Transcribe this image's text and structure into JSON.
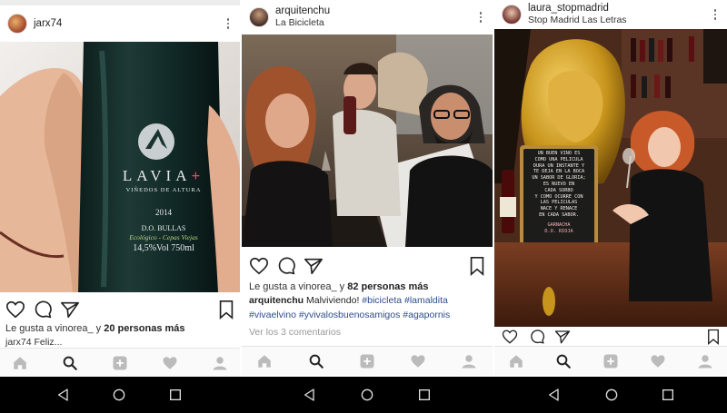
{
  "posts": [
    {
      "username": "jarx74",
      "location": "",
      "likes_prefix": "Le gusta a vinorea_ y ",
      "likes_count": "20 personas más",
      "caption_user": "",
      "caption_text": "",
      "caption_tags": [],
      "comments_link": "",
      "cutoff_text": "jarx74 Feliz...",
      "label": {
        "brand": "LAVIA",
        "brand_mark": "+",
        "subtitle": "VIÑEDOS DE ALTURA",
        "year": "2014",
        "do": "D.O. BULLAS",
        "eco": "Ecológico - Cepas Viejas",
        "abv": "14,5%Vol 750ml"
      }
    },
    {
      "username": "arquitenchu",
      "location": "La Bicicleta",
      "likes_prefix": "Le gusta a vinorea_ y ",
      "likes_count": "82 personas más",
      "caption_user": "arquitenchu",
      "caption_text": " Malviviendo! ",
      "caption_tags": [
        "#bicicleta",
        "#lamaldita",
        "#vivaelvino",
        "#yvivalosbuenosamigos",
        "#agapornis"
      ],
      "comments_link": "Ver los 3 comentarios"
    },
    {
      "username": "laura_stopmadrid",
      "location": "Stop Madrid Las Letras",
      "likes_prefix": "",
      "likes_count": "",
      "caption_user": "",
      "caption_text": "",
      "caption_tags": [],
      "comments_link": "",
      "chalkboard": [
        "UN BUEN VINO ES",
        "COMO UNA PELICULA",
        "DURA UN INSTANTE Y",
        "TE DEJA EN LA BOCA",
        "UN SABOR DE GLORIA;",
        "ES NUEVO EN",
        "CADA SORBO",
        "Y COMO OCURRE CON",
        "LAS PELICULAS",
        "NACE Y RENACE",
        "EN CADA SABOR."
      ],
      "chalk_footer": "GARNACHA",
      "chalk_footer2": "D.O. RIOJA"
    }
  ],
  "theme": {
    "tag_color": "#2e4e8c",
    "nav_bg": "#fafafa",
    "system_bar": "#000000"
  },
  "icons": {
    "post_actions": [
      "heart-icon",
      "comment-icon",
      "share-icon",
      "bookmark-icon"
    ],
    "nav": [
      "home-icon",
      "search-icon",
      "add-icon",
      "activity-heart-icon",
      "profile-icon"
    ],
    "system": [
      "back-icon",
      "home-circle-icon",
      "recents-icon"
    ]
  }
}
